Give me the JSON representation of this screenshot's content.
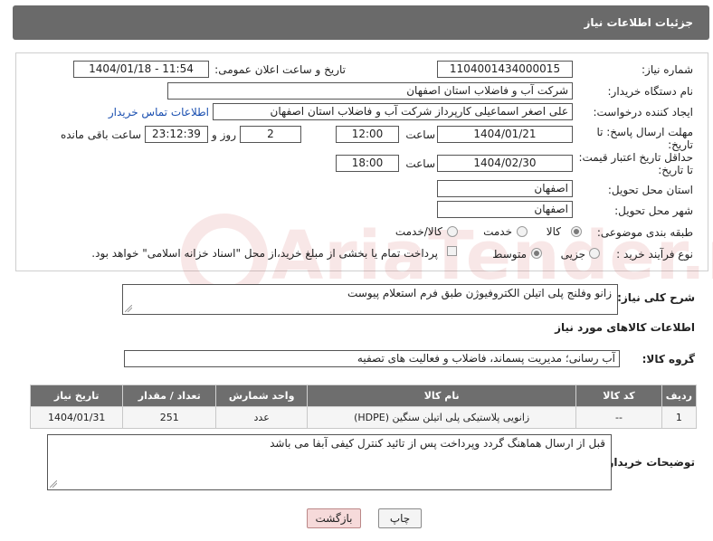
{
  "header": {
    "title": "جزئیات اطلاعات نیاز"
  },
  "form": {
    "need_number": {
      "label": "شماره نیاز:",
      "value": "1104001434000015"
    },
    "announce_datetime": {
      "label": "تاریخ و ساعت اعلان عمومی:",
      "value": "1404/01/18 - 11:54"
    },
    "buyer_org": {
      "label": "نام دستگاه خریدار:",
      "value": "شرکت آب و فاضلاب استان اصفهان"
    },
    "requester": {
      "label": "ایجاد کننده درخواست:",
      "value": "علی اصغر اسماعیلی کارپرداز شرکت آب و فاضلاب استان اصفهان",
      "contact_link": "اطلاعات تماس خریدار"
    },
    "reply_deadline": {
      "label_line1": "مهلت ارسال پاسخ: تا",
      "label_line2": "تاریخ:",
      "date": "1404/01/21",
      "time_label": "ساعت",
      "time": "12:00",
      "days": "2",
      "days_label": "روز و",
      "remaining": "23:12:39",
      "remaining_label": "ساعت باقی مانده"
    },
    "price_validity": {
      "label_line1": "حداقل تاریخ اعتبار قیمت:",
      "label_line2": "تا تاریخ:",
      "date": "1404/02/30",
      "time_label": "ساعت",
      "time": "18:00"
    },
    "delivery_province": {
      "label": "استان محل تحویل:",
      "value": "اصفهان"
    },
    "delivery_city": {
      "label": "شهر محل تحویل:",
      "value": "اصفهان"
    },
    "category": {
      "label": "طبقه بندی موضوعی:",
      "options": [
        "کالا",
        "خدمت",
        "کالا/خدمت"
      ],
      "selected": "کالا"
    },
    "purchase_process": {
      "label": "نوع فرآیند خرید :",
      "options": [
        "جزیی",
        "متوسط"
      ],
      "selected": "متوسط",
      "payment_note": "پرداخت تمام یا بخشی از مبلغ خرید،از محل \"اسناد خزانه اسلامی\" خواهد بود."
    }
  },
  "watermark": {
    "text": "AriaTender.neT"
  },
  "description": {
    "label": "شرح کلی نیاز:",
    "value": "زانو وفلنج پلی اتیلن الکتروفیوژن طبق فرم استعلام پیوست"
  },
  "goods_info": {
    "title": "اطلاعات کالاهای مورد نیاز",
    "group_label": "گروه کالا:",
    "group_value": "آب رسانی؛ مدیریت پسماند، فاضلاب و فعالیت های تصفیه",
    "columns": [
      "ردیف",
      "کد کالا",
      "نام کالا",
      "واحد شمارش",
      "تعداد / مقدار",
      "تاریخ نیاز"
    ],
    "rows": [
      [
        "1",
        "--",
        "زانویی پلاستیکی پلی اتیلن سنگین (HDPE)",
        "عدد",
        "251",
        "1404/01/31"
      ]
    ]
  },
  "buyer_notes": {
    "label": "توضیحات خریدار:",
    "value": "قبل از ارسال هماهنگ گردد وپرداخت پس از تائید کنترل کیفی آبفا می باشد"
  },
  "buttons": {
    "print": "چاپ",
    "back": "بازگشت"
  }
}
